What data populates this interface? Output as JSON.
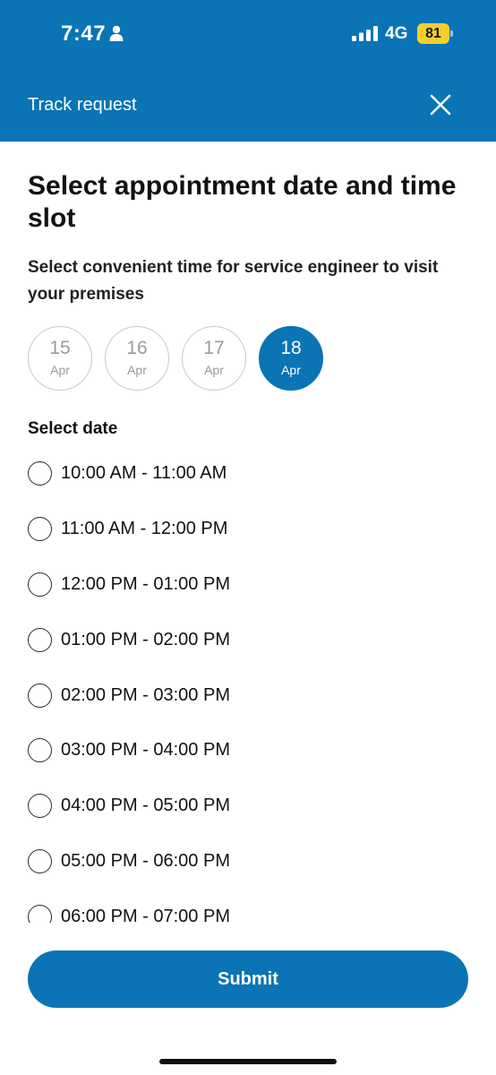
{
  "status_bar": {
    "time": "7:47",
    "network": "4G",
    "battery": "81",
    "battery_color": "#f5cf2c"
  },
  "header": {
    "title": "Track request",
    "close_icon": "close-icon",
    "background": "#0a74b4"
  },
  "main": {
    "title": "Select appointment date and time slot",
    "subtitle": "Select convenient time for service engineer to visit your premises",
    "dates": [
      {
        "day": "15",
        "month": "Apr",
        "selected": false
      },
      {
        "day": "16",
        "month": "Apr",
        "selected": false
      },
      {
        "day": "17",
        "month": "Apr",
        "selected": false
      },
      {
        "day": "18",
        "month": "Apr",
        "selected": true
      }
    ],
    "section_label": "Select date",
    "time_slots": [
      "10:00 AM - 11:00 AM",
      "11:00 AM - 12:00 PM",
      "12:00 PM - 01:00 PM",
      "01:00 PM - 02:00 PM",
      "02:00 PM - 03:00 PM",
      "03:00 PM - 04:00 PM",
      "04:00 PM - 05:00 PM",
      "05:00 PM - 06:00 PM",
      "06:00 PM - 07:00 PM"
    ]
  },
  "footer": {
    "submit_label": "Submit"
  }
}
